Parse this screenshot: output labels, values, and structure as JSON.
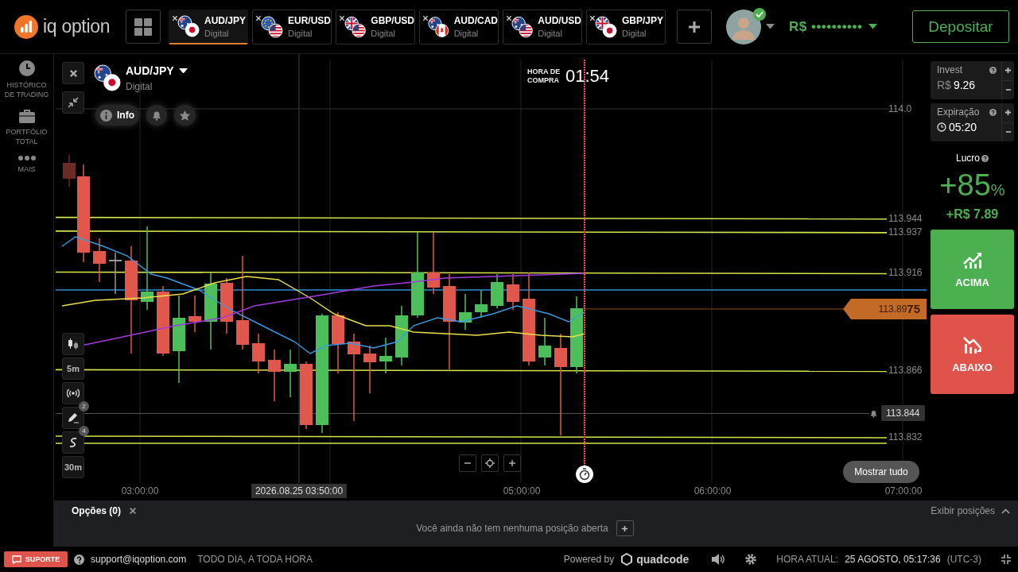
{
  "header": {
    "logo": "iq option",
    "tabs": [
      {
        "pair": "AUD/JPY",
        "type": "Digital",
        "selected": true
      },
      {
        "pair": "EUR/USD",
        "type": "Digital",
        "selected": false
      },
      {
        "pair": "GBP/USD",
        "type": "Digital",
        "selected": false
      },
      {
        "pair": "AUD/CAD",
        "type": "Digital",
        "selected": false
      },
      {
        "pair": "AUD/USD",
        "type": "Digital",
        "selected": false
      },
      {
        "pair": "GBP/JPY",
        "type": "Digital",
        "selected": false
      }
    ],
    "balance": "R$ ••••••••••",
    "deposit_button": "Depositar"
  },
  "sidebar": {
    "items": [
      {
        "label": "HISTÓRICO DE TRADING"
      },
      {
        "label": "PORTFÓLIO TOTAL"
      },
      {
        "label": "MAIS"
      }
    ]
  },
  "chart": {
    "asset": {
      "pair": "AUD/JPY",
      "type": "Digital"
    },
    "info_button": "Info",
    "tools": [
      {
        "kind": "chart-type"
      },
      {
        "kind": "text",
        "label": "5m"
      },
      {
        "kind": "signals"
      },
      {
        "kind": "drawing",
        "badge": "2"
      },
      {
        "kind": "indicators",
        "badge": "4"
      },
      {
        "kind": "text",
        "label": "30m"
      }
    ],
    "purchase_time": {
      "label": "HORA DE COMPRA",
      "value": "01:54"
    },
    "price_levels": [
      {
        "label": "114.0",
        "kind": "grid"
      },
      {
        "label": "113.944",
        "kind": "level"
      },
      {
        "label": "113.937",
        "kind": "level"
      },
      {
        "label": "113.916",
        "kind": "level"
      },
      {
        "label": "113.866",
        "kind": "level"
      },
      {
        "label": "113.832",
        "kind": "level"
      }
    ],
    "current_price": "113.89**75**",
    "alert_price": "113.844",
    "time_ticks": [
      "03:00:00",
      "05:00:00",
      "06:00:00",
      "07:00:00"
    ],
    "crosshair_time": "2026.08.25 03:50:00",
    "show_all_button": "Mostrar tudo"
  },
  "trade_panel": {
    "invest": {
      "label": "Invest",
      "currency": "R$",
      "value": "9.26"
    },
    "expiration": {
      "label": "Expiração",
      "value": "05:20"
    },
    "profit": {
      "label": "Lucro",
      "percent": "+85",
      "unit": "%",
      "amount": "+R$ 7.89"
    },
    "up_button": "ACIMA",
    "down_button": "ABAIXO"
  },
  "options_bar": {
    "title": "Opções (0)",
    "show_positions": "Exibir posições",
    "empty_message": "Você ainda não tem nenhuma posição aberta"
  },
  "footer": {
    "support_button": "SUPORTE",
    "email": "support@iqoption.com",
    "hours": "TODO DIA, A TODA HORA",
    "powered_by": "Powered by",
    "brand": "quadcode",
    "time_label": "HORA ATUAL:",
    "time_value": "25 AGOSTO, 05:17:36",
    "timezone": "(UTC-3)"
  }
}
